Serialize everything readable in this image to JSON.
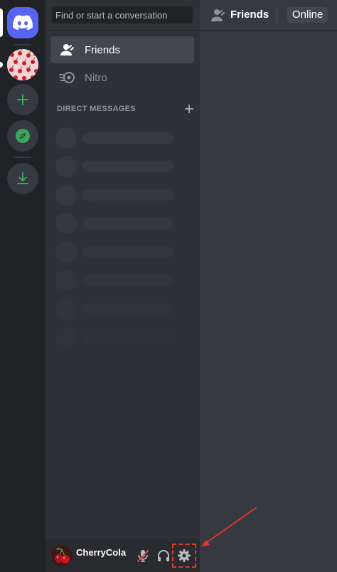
{
  "search": {
    "placeholder": "Find or start a conversation"
  },
  "nav": {
    "friends_label": "Friends",
    "nitro_label": "Nitro"
  },
  "dm_section": {
    "header": "DIRECT MESSAGES"
  },
  "header": {
    "title": "Friends",
    "tab_online": "Online"
  },
  "user": {
    "name": "CherryCola"
  },
  "colors": {
    "blurple": "#5865f2",
    "green": "#3ba55d",
    "annotation": "#e23a27"
  }
}
